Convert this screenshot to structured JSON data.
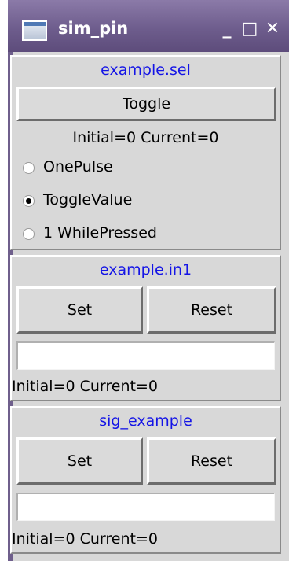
{
  "window": {
    "title": "sim_pin",
    "min_glyph": "_",
    "max_glyph": "□",
    "close_glyph": "✕"
  },
  "pins": [
    {
      "name": "example.sel",
      "toggle_label": "Toggle",
      "status": "Initial=0 Current=0",
      "mode_options": [
        {
          "label": "OnePulse",
          "selected": false
        },
        {
          "label": "ToggleValue",
          "selected": true
        },
        {
          "label": "1 WhilePressed",
          "selected": false
        }
      ]
    },
    {
      "name": "example.in1",
      "set_label": "Set",
      "reset_label": "Reset",
      "entry_value": "",
      "status": "Initial=0 Current=0"
    },
    {
      "name": "sig_example",
      "set_label": "Set",
      "reset_label": "Reset",
      "entry_value": "",
      "status": "Initial=0 Current=0"
    }
  ],
  "colors": {
    "titlebar": "#6e5d8d",
    "pin_name": "#1414e6",
    "panel": "#d8d8d8"
  }
}
